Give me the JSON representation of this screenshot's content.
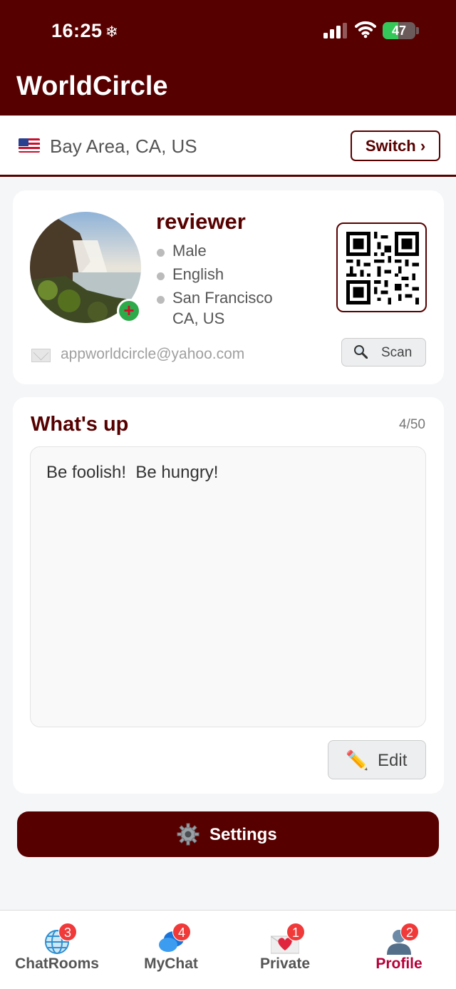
{
  "status_bar": {
    "time": "16:25",
    "time_glyph": "❄",
    "battery": "47",
    "battery_level": 0.47
  },
  "header": {
    "title": "WorldCircle"
  },
  "location": {
    "text": "Bay Area, CA, US",
    "switch_label": "Switch ›"
  },
  "profile": {
    "username": "reviewer",
    "gender": "Male",
    "language": "English",
    "city_line1": "San Francisco",
    "city_line2": "CA, US",
    "email": "appworldcircle@yahoo.com",
    "scan_label": "Scan"
  },
  "status_card": {
    "title": "What's up",
    "counter": "4/50",
    "text": "Be foolish!  Be hungry!",
    "edit_label": "Edit",
    "edit_icon": "✏️"
  },
  "settings": {
    "label": "Settings"
  },
  "tabs": [
    {
      "label": "ChatRooms",
      "badge": "3",
      "icon": "globe-icon"
    },
    {
      "label": "MyChat",
      "badge": "4",
      "icon": "chat-bubbles-icon"
    },
    {
      "label": "Private",
      "badge": "1",
      "icon": "heart-envelope-icon"
    },
    {
      "label": "Profile",
      "badge": "2",
      "icon": "person-icon"
    }
  ],
  "colors": {
    "brand": "#570000",
    "active_tab": "#b5003a",
    "badge": "#f03a3a",
    "online": "#2eaa4a"
  }
}
